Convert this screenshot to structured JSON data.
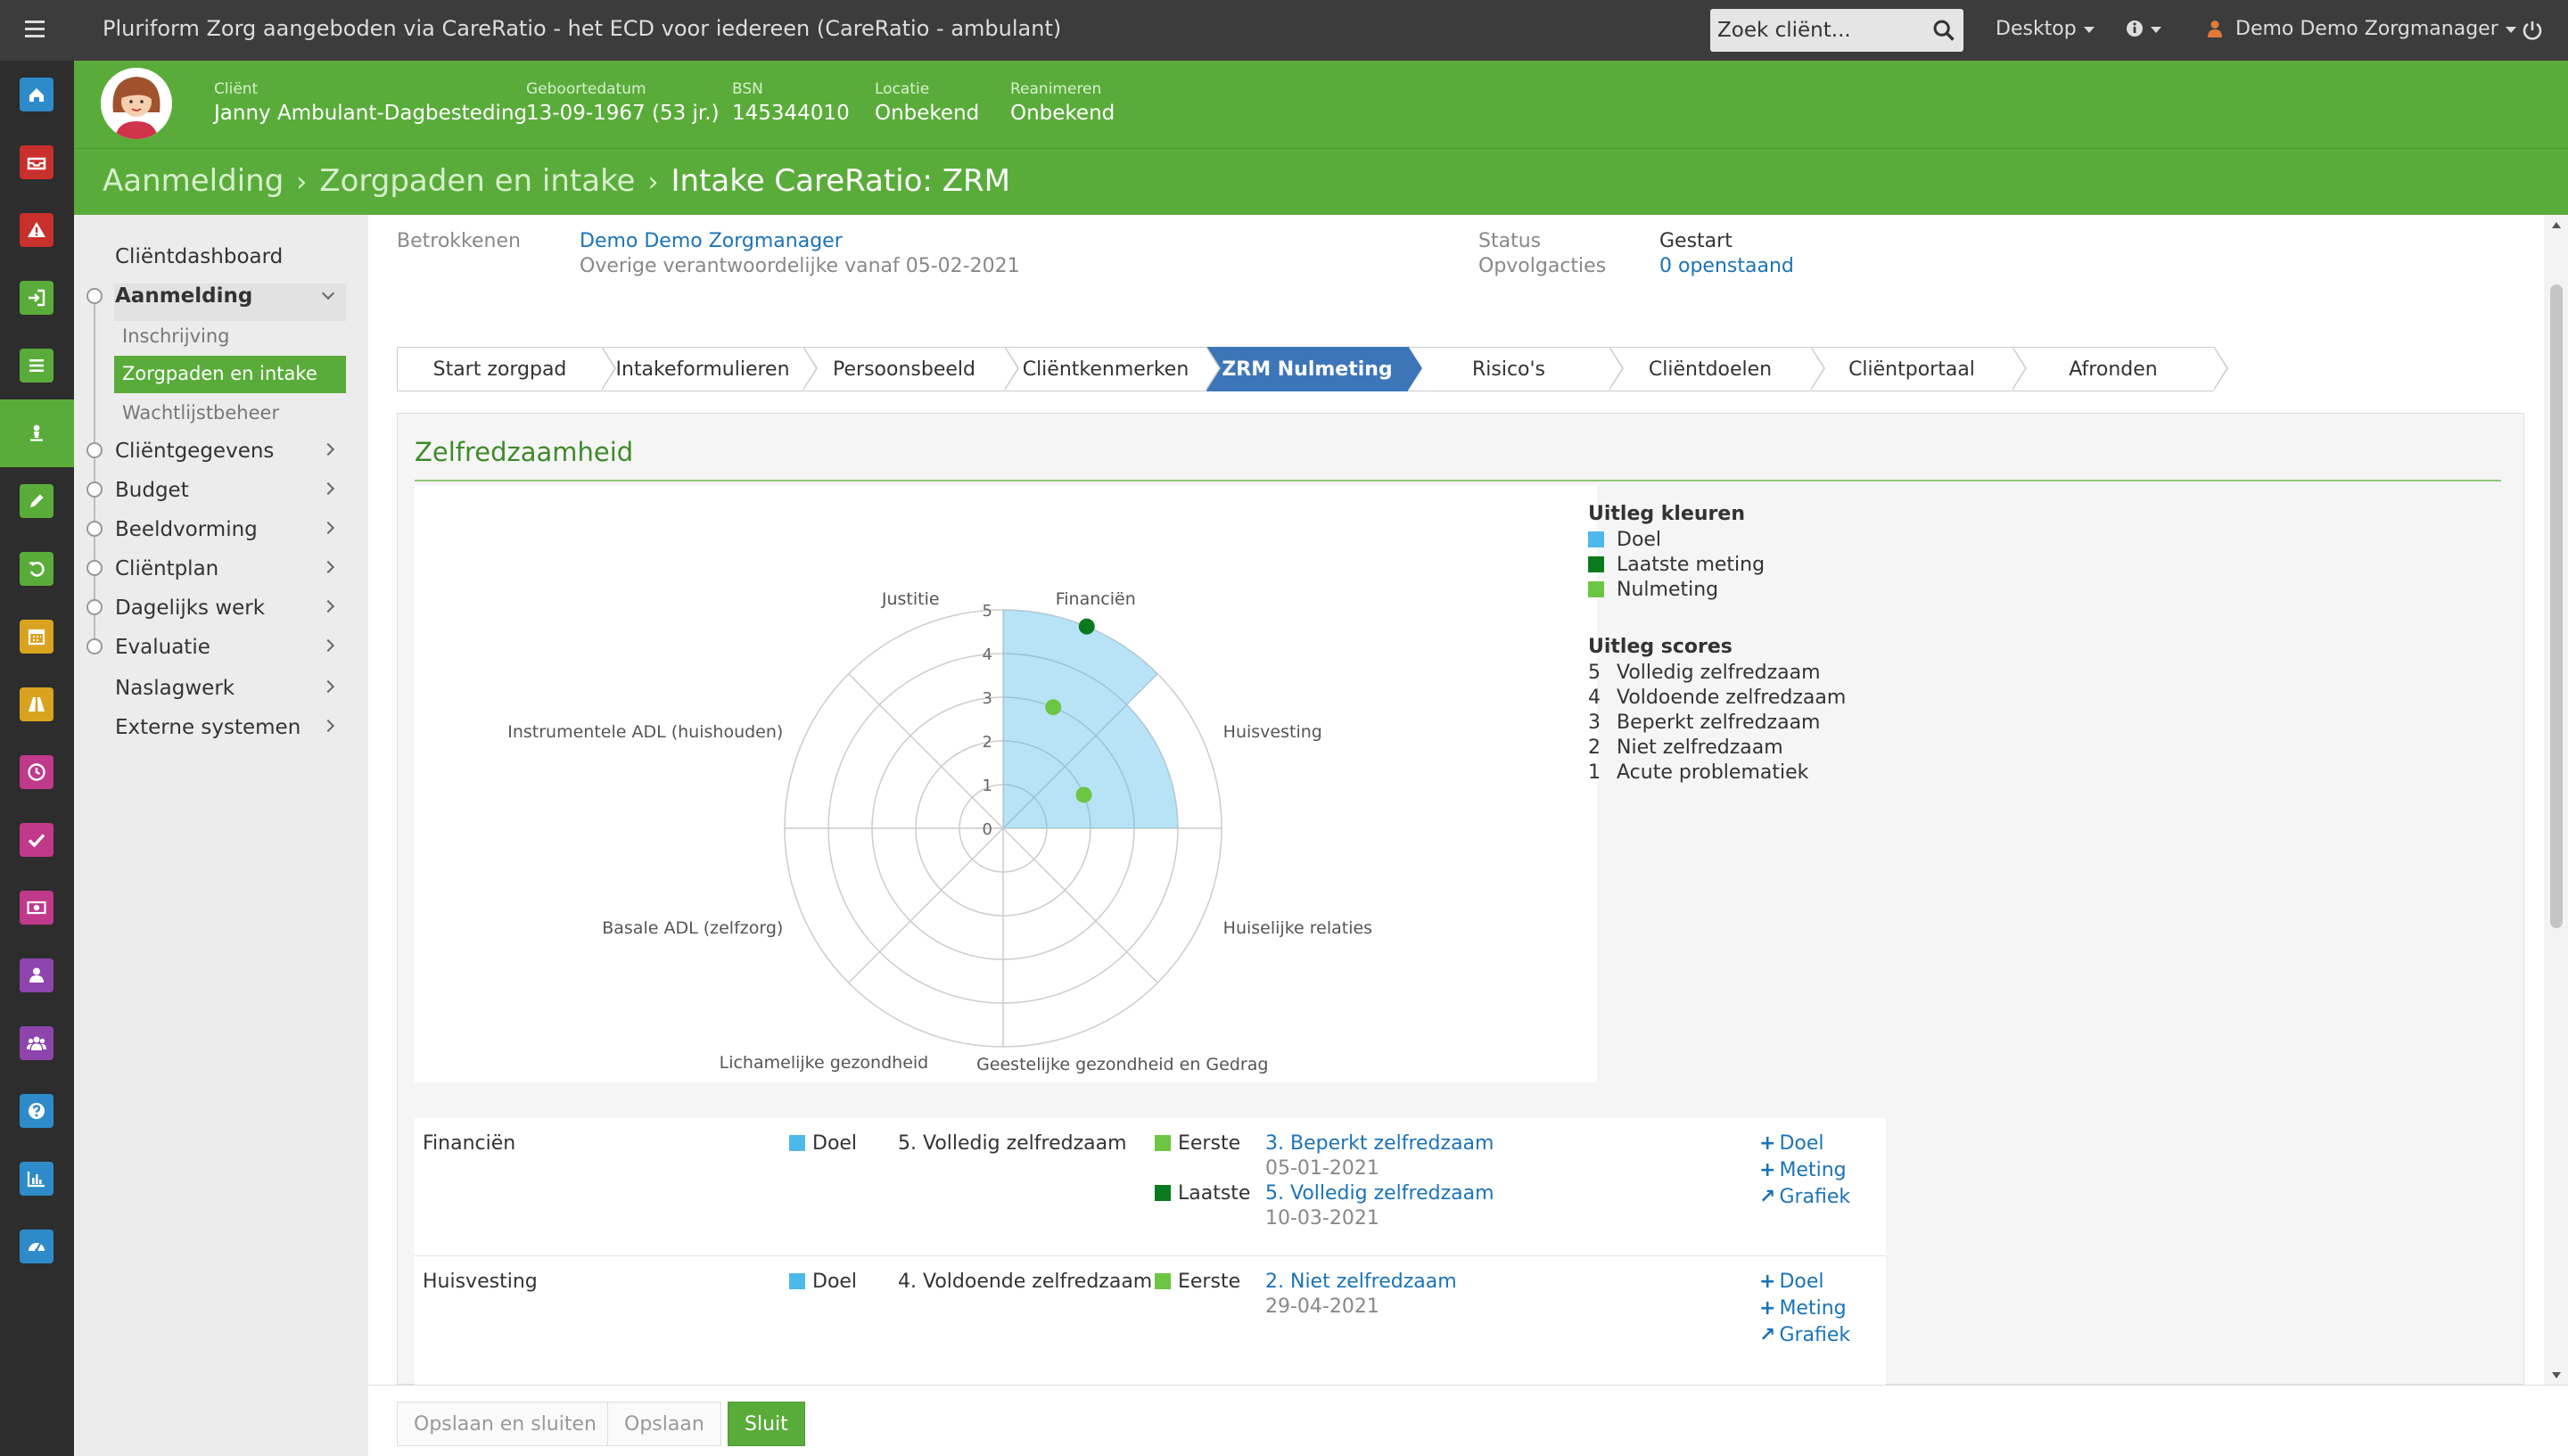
{
  "topbar": {
    "title": "Pluriform Zorg aangeboden via CareRatio - het ECD voor iedereen  (CareRatio - ambulant)",
    "search_placeholder": "Zoek cliënt...",
    "desktop_label": "Desktop",
    "user_label": "Demo Demo Zorgmanager"
  },
  "rail": {
    "icons": [
      "home-icon",
      "inbox-icon",
      "warning-icon",
      "sign-in-icon",
      "list-icon",
      "user-pin-icon",
      "pencil-icon",
      "undo-icon",
      "calendar-icon",
      "road-icon",
      "clock-icon",
      "check-icon",
      "money-icon",
      "person-icon",
      "group-icon",
      "help-icon",
      "bar-chart-icon",
      "dashboard-icon"
    ],
    "colors": [
      "#2e8bc9",
      "#c9302c",
      "#c9302c",
      "#5aac3a",
      "#5aac3a",
      "#5aac3a",
      "#5aac3a",
      "#5aac3a",
      "#d9a320",
      "#d9a320",
      "#c0398b",
      "#c0398b",
      "#c0398b",
      "#8e44ad",
      "#8e44ad",
      "#2e8bc9",
      "#2e8bc9",
      "#2e8bc9"
    ]
  },
  "client": {
    "fields": [
      {
        "label": "Cliënt",
        "value": "Janny Ambulant-Dagbesteding"
      },
      {
        "label": "Geboortedatum",
        "value": "13-09-1967 (53 jr.)"
      },
      {
        "label": "BSN",
        "value": "145344010"
      },
      {
        "label": "Locatie",
        "value": "Onbekend"
      },
      {
        "label": "Reanimeren",
        "value": "Onbekend"
      }
    ]
  },
  "breadcrumb": [
    "Aanmelding",
    "Zorgpaden en intake",
    "Intake CareRatio: ZRM"
  ],
  "sidenav": {
    "items": [
      "Cliëntdashboard",
      "Aanmelding",
      "Cliëntgegevens",
      "Budget",
      "Beeldvorming",
      "Cliëntplan",
      "Dagelijks werk",
      "Evaluatie",
      "Naslagwerk",
      "Externe systemen"
    ],
    "sub_items": [
      "Inschrijving",
      "Zorgpaden en intake",
      "Wachtlijstbeheer"
    ]
  },
  "info": {
    "betrokkenen_label": "Betrokkenen",
    "betrokkenen_value": "Demo Demo Zorgmanager",
    "betrokkenen_sub": "Overige verantwoordelijke vanaf 05-02-2021",
    "status_label": "Status",
    "status_value": "Gestart",
    "opvolg_label": "Opvolgacties",
    "opvolg_value": "0 openstaand"
  },
  "steps": [
    "Start zorgpad",
    "Intakeformulieren",
    "Persoonsbeeld",
    "Cliëntkenmerken",
    "ZRM Nulmeting",
    "Risico's",
    "Cliëntdoelen",
    "Cliëntportaal",
    "Afronden"
  ],
  "active_step": 4,
  "panel_title": "Zelfredzaamheid",
  "legend": {
    "colors_title": "Uitleg kleuren",
    "colors": [
      {
        "label": "Doel",
        "color": "#4db8ea"
      },
      {
        "label": "Laatste meting",
        "color": "#0b7a1f"
      },
      {
        "label": "Nulmeting",
        "color": "#6cc644"
      }
    ],
    "scores_title": "Uitleg scores",
    "scores": [
      {
        "num": "5",
        "label": "Volledig zelfredzaam"
      },
      {
        "num": "4",
        "label": "Voldoende zelfredzaam"
      },
      {
        "num": "3",
        "label": "Beperkt zelfredzaam"
      },
      {
        "num": "2",
        "label": "Niet zelfredzaam"
      },
      {
        "num": "1",
        "label": "Acute problematiek"
      }
    ]
  },
  "chart_data": {
    "type": "polar",
    "categories": [
      "Financiën",
      "Huisvesting",
      "Huiselijke relaties",
      "Geestelijke gezondheid en Gedrag",
      "Lichamelijke gezondheid",
      "Basale ADL (zelfzorg)",
      "Instrumentele ADL (huishouden)",
      "Justitie"
    ],
    "radial_ticks": [
      "0",
      "1",
      "2",
      "3",
      "4",
      "5"
    ],
    "rmax": 5,
    "series": [
      {
        "name": "Doel",
        "type": "wedge",
        "values": [
          5,
          4,
          null,
          null,
          null,
          null,
          null,
          null
        ]
      },
      {
        "name": "Laatste meting",
        "type": "point",
        "values": [
          5,
          null,
          null,
          null,
          null,
          null,
          null,
          null
        ]
      },
      {
        "name": "Nulmeting",
        "type": "point",
        "values": [
          3,
          2,
          null,
          null,
          null,
          null,
          null,
          null
        ]
      }
    ]
  },
  "scores": [
    {
      "domain": "Financiën",
      "doel_label": "Doel",
      "doel_value": "5. Volledig zelfredzaam",
      "measurements": [
        {
          "label": "Eerste",
          "value": "3. Beperkt zelfredzaam",
          "date": "05-01-2021"
        },
        {
          "label": "Laatste",
          "value": "5. Volledig zelfredzaam",
          "date": "10-03-2021"
        }
      ],
      "actions": [
        "Doel",
        "Meting",
        "Grafiek"
      ]
    },
    {
      "domain": "Huisvesting",
      "doel_label": "Doel",
      "doel_value": "4. Voldoende zelfredzaam",
      "measurements": [
        {
          "label": "Eerste",
          "value": "2. Niet zelfredzaam",
          "date": "29-04-2021"
        }
      ],
      "actions": [
        "Doel",
        "Meting",
        "Grafiek"
      ]
    }
  ],
  "buttons": {
    "save_close": "Opslaan en sluiten",
    "save": "Opslaan",
    "close": "Sluit"
  }
}
